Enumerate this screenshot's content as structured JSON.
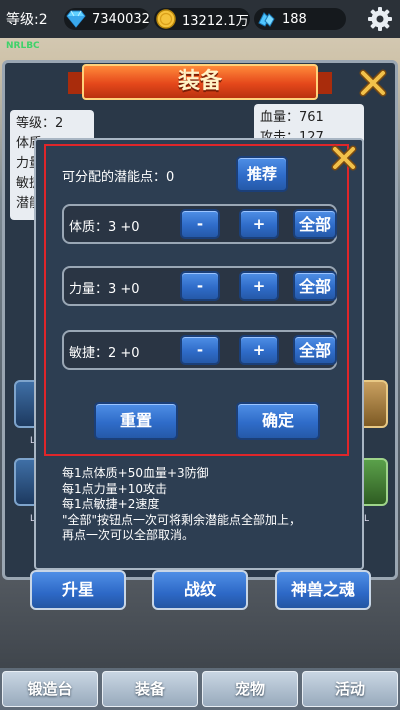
{
  "topbar": {
    "level": "等级:2",
    "diamonds": "7340032",
    "gold": "13212.1万",
    "crystals": "188",
    "tag": "NRLBC"
  },
  "equipment_panel": {
    "title": "装备",
    "stats_left": [
      "等级：2",
      "体质",
      "力量",
      "敏捷",
      "潜能"
    ],
    "stats_right": [
      "血量：761",
      "攻击：127"
    ],
    "slot_labels": [
      "L",
      "L",
      "L"
    ],
    "tabs": [
      "升星",
      "战纹",
      "神兽之魂"
    ]
  },
  "modal": {
    "points_label": "可分配的潜能点：0",
    "recommend_label": "推荐",
    "rows": [
      {
        "label": "体质：3 +0",
        "minus": "-",
        "plus": "+",
        "all": "全部"
      },
      {
        "label": "力量：3 +0",
        "minus": "-",
        "plus": "+",
        "all": "全部"
      },
      {
        "label": "敏捷：2 +0",
        "minus": "-",
        "plus": "+",
        "all": "全部"
      }
    ],
    "reset_label": "重置",
    "confirm_label": "确定",
    "description": [
      "每1点体质+50血量+3防御",
      "每1点力量+10攻击",
      "每1点敏捷+2速度",
      "\"全部\"按钮点一次可将剩余潜能点全部加上，",
      "再点一次可以全部取消。"
    ]
  },
  "bottom_nav": [
    "锻造台",
    "装备",
    "宠物",
    "活动"
  ],
  "colors": {
    "accent_blue": "#2f6cc9",
    "banner_orange": "#e5481b",
    "highlight_red": "#e0262a",
    "close_gold": "#f2c14a"
  },
  "icons": [
    "diamond-icon",
    "gold-coin-icon",
    "crystal-icon",
    "settings-gear-icon",
    "close-x-icon"
  ]
}
